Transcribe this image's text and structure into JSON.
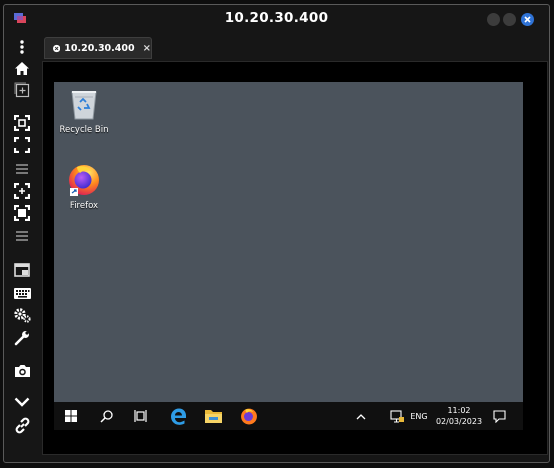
{
  "window": {
    "title": "10.20.30.400",
    "close_color": "#2f73d6"
  },
  "sidebar": {
    "icons": [
      "menu-dots-icon",
      "home-icon",
      "new-window-icon",
      "fit-screen-icon",
      "fullscreen-icon",
      "separator-icon",
      "fit-screen-alt-icon",
      "fullscreen-exit-icon",
      "separator-icon",
      "screenshot-window-icon",
      "keyboard-icon",
      "settings-icon",
      "tools-icon",
      "camera-icon",
      "chevron-down-icon",
      "link-icon"
    ]
  },
  "tab": {
    "label": "10.20.30.400",
    "close_label": "×"
  },
  "desktop": {
    "background": "#4b535c",
    "icons": [
      {
        "label": "Recycle Bin",
        "icon": "recycle-bin-icon"
      },
      {
        "label": "Firefox",
        "icon": "firefox-icon"
      }
    ]
  },
  "taskbar": {
    "language": "ENG",
    "time": "11:02",
    "date": "02/03/2023",
    "items": [
      "windows-start-icon",
      "search-icon",
      "task-view-icon",
      "edge-icon",
      "file-explorer-icon",
      "firefox-icon"
    ]
  }
}
